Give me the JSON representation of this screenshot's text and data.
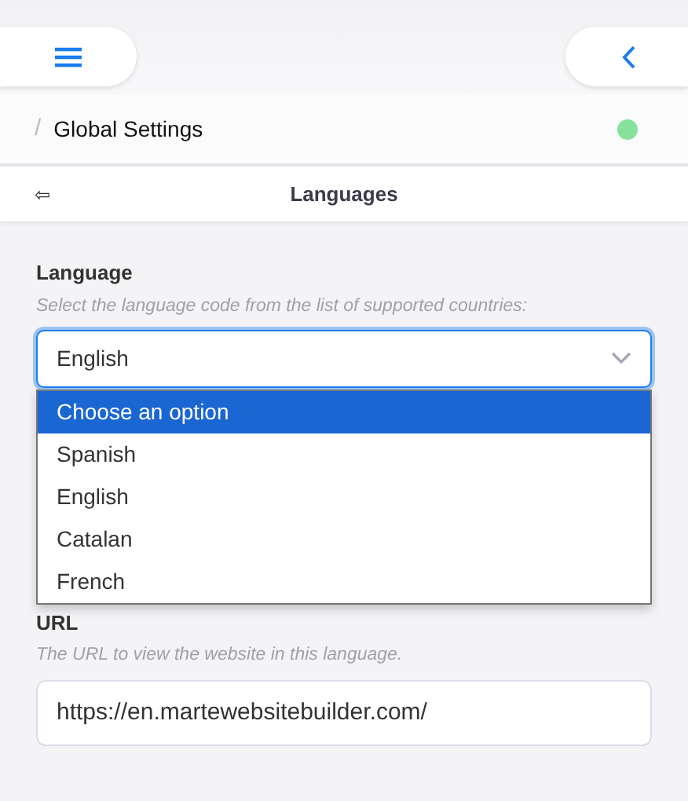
{
  "breadcrumb": {
    "separator": "/",
    "title": "Global Settings"
  },
  "panel": {
    "back": "⇦",
    "title": "Languages"
  },
  "language_field": {
    "label": "Language",
    "hint": "Select the language code from the list of supported countries:",
    "value": "English",
    "expanded": true,
    "options": [
      {
        "label": "Choose an option",
        "highlighted": true
      },
      {
        "label": "Spanish",
        "highlighted": false
      },
      {
        "label": "English",
        "highlighted": false
      },
      {
        "label": "Catalan",
        "highlighted": false
      },
      {
        "label": "French",
        "highlighted": false
      }
    ]
  },
  "url_field": {
    "label": "URL",
    "hint": "The URL to view the website in this language.",
    "value": "https://en.martewebsitebuilder.com/"
  }
}
